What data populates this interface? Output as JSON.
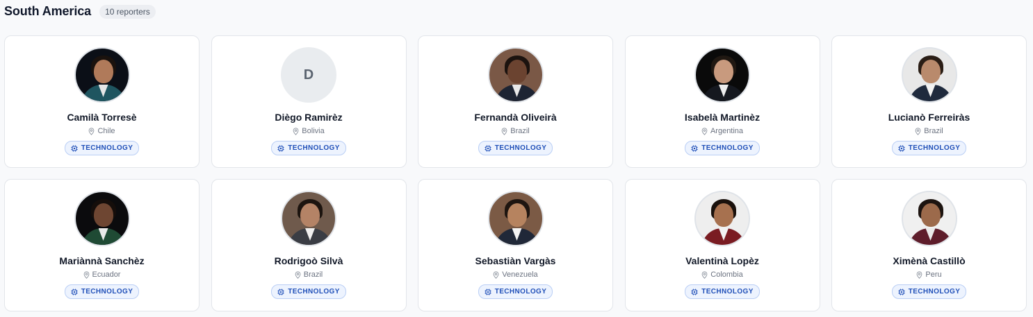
{
  "section": {
    "title": "South America",
    "count": "10 reporters"
  },
  "reporters": [
    {
      "name": "Camilà Torresè",
      "location": "Chile",
      "tag": "TECHNOLOGY",
      "initial": "",
      "bg": "#0b0f17",
      "skin": "#b07a5a",
      "hair": "#1a120e",
      "suit": "#1f5560",
      "shirt": "#e6e6e6"
    },
    {
      "name": "Diègo Ramirèz",
      "location": "Bolivia",
      "tag": "TECHNOLOGY",
      "initial": "D",
      "bg": "",
      "skin": "",
      "hair": "",
      "suit": "",
      "shirt": ""
    },
    {
      "name": "Fernandà Oliveirà",
      "location": "Brazil",
      "tag": "TECHNOLOGY",
      "initial": "",
      "bg": "#7a5846",
      "skin": "#6b4330",
      "hair": "#1c130f",
      "suit": "#1d2433",
      "shirt": "#e9e9e9"
    },
    {
      "name": "Isabelà Martinèz",
      "location": "Argentina",
      "tag": "TECHNOLOGY",
      "initial": "",
      "bg": "#0a0a0a",
      "skin": "#c89a7e",
      "hair": "#201812",
      "suit": "#15181f",
      "shirt": "#eeeeee"
    },
    {
      "name": "Lucianò Ferreiràs",
      "location": "Brazil",
      "tag": "TECHNOLOGY",
      "initial": "",
      "bg": "#e8e8e8",
      "skin": "#b98a6c",
      "hair": "#2a1d15",
      "suit": "#1f2a3d",
      "shirt": "#f2f2f2"
    },
    {
      "name": "Mariànnà Sanchèz",
      "location": "Ecuador",
      "tag": "TECHNOLOGY",
      "initial": "",
      "bg": "#0b0b0d",
      "skin": "#6e4632",
      "hair": "#150e0b",
      "suit": "#1f4a34",
      "shirt": "#e9e9e9"
    },
    {
      "name": "Rodrigoò Silvà",
      "location": "Brazil",
      "tag": "TECHNOLOGY",
      "initial": "",
      "bg": "#6f5a4c",
      "skin": "#b48366",
      "hair": "#1c140f",
      "suit": "#3a3d44",
      "shirt": "#f0f0f0"
    },
    {
      "name": "Sebastiàn Vargàs",
      "location": "Venezuela",
      "tag": "TECHNOLOGY",
      "initial": "",
      "bg": "#7b5a45",
      "skin": "#b6835f",
      "hair": "#1e1510",
      "suit": "#202838",
      "shirt": "#f4f4f4"
    },
    {
      "name": "Valentinà Lopèz",
      "location": "Colombia",
      "tag": "TECHNOLOGY",
      "initial": "",
      "bg": "#eeeeee",
      "skin": "#a7714f",
      "hair": "#1a110c",
      "suit": "#7a1c22",
      "shirt": "#f2f2f2"
    },
    {
      "name": "Ximènà Castillò",
      "location": "Peru",
      "tag": "TECHNOLOGY",
      "initial": "",
      "bg": "#f0f0f0",
      "skin": "#9c6a4b",
      "hair": "#1d1410",
      "suit": "#5e1d2b",
      "shirt": "#eaeaea"
    }
  ],
  "colors": {
    "accent": "#1f4fb8",
    "tag_bg": "#edf3fe",
    "tag_border": "#b9cef5"
  },
  "icons": {
    "location": "map-pin-icon",
    "tag": "cpu-chip-icon"
  }
}
